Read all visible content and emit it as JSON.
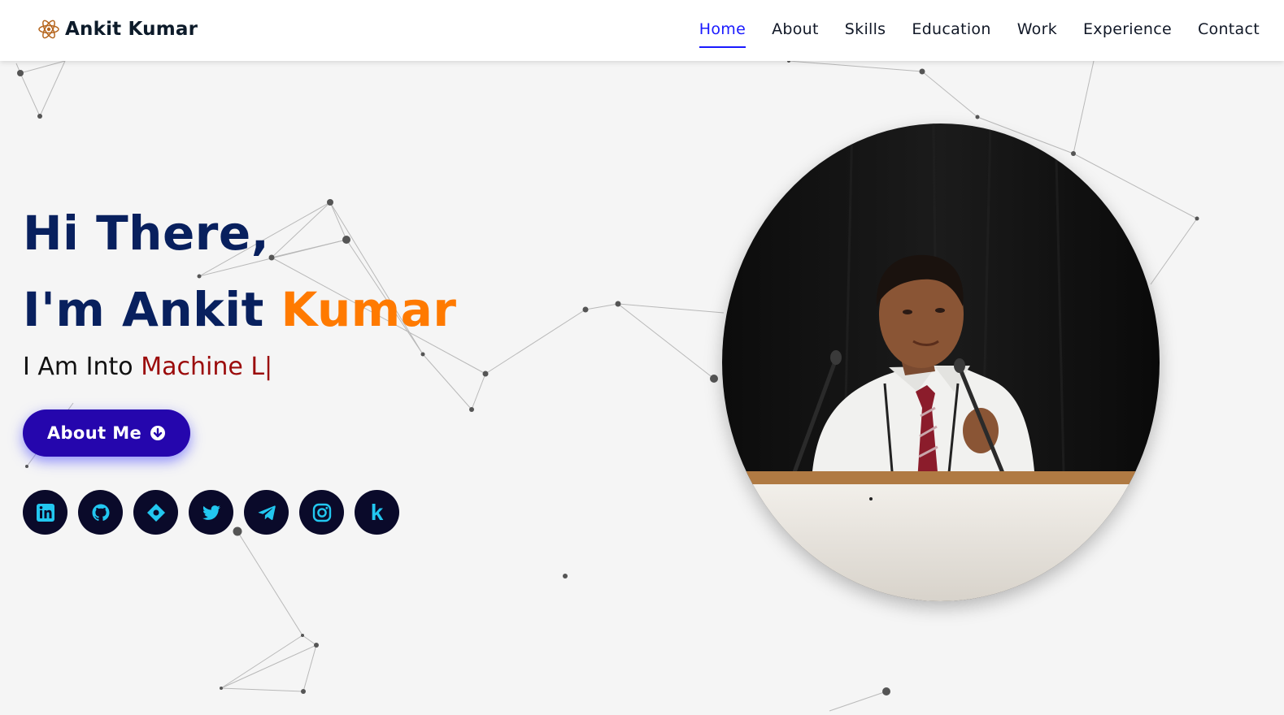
{
  "brand": {
    "name": "Ankit Kumar",
    "icon": "atom-icon",
    "icon_color": "#b5651d"
  },
  "nav": {
    "items": [
      {
        "label": "Home",
        "active": true
      },
      {
        "label": "About",
        "active": false
      },
      {
        "label": "Skills",
        "active": false
      },
      {
        "label": "Education",
        "active": false
      },
      {
        "label": "Work",
        "active": false
      },
      {
        "label": "Experience",
        "active": false
      },
      {
        "label": "Contact",
        "active": false
      }
    ],
    "active_color": "#1a1aff"
  },
  "hero": {
    "greeting": "Hi There,",
    "intro": "I'm Ankit",
    "highlight": "Kumar",
    "typed_prefix": "I Am Into",
    "typed_text": "Machine L",
    "caret": "|",
    "button_label": "About Me",
    "button_icon": "arrow-down-circle-icon"
  },
  "socials": [
    {
      "name": "linkedin-icon"
    },
    {
      "name": "github-icon"
    },
    {
      "name": "diamond-icon"
    },
    {
      "name": "twitter-icon"
    },
    {
      "name": "telegram-icon"
    },
    {
      "name": "instagram-icon"
    },
    {
      "name": "k-icon",
      "glyph": "k"
    }
  ],
  "colors": {
    "title": "#08205e",
    "accent_orange": "#ff7a00",
    "typed_red": "#9b0b0b",
    "button": "#2506ad",
    "social_bg": "#0a0a2a",
    "social_icon": "#22c7f0"
  },
  "photo": {
    "alt": "Ankit Kumar speaking at podium"
  }
}
